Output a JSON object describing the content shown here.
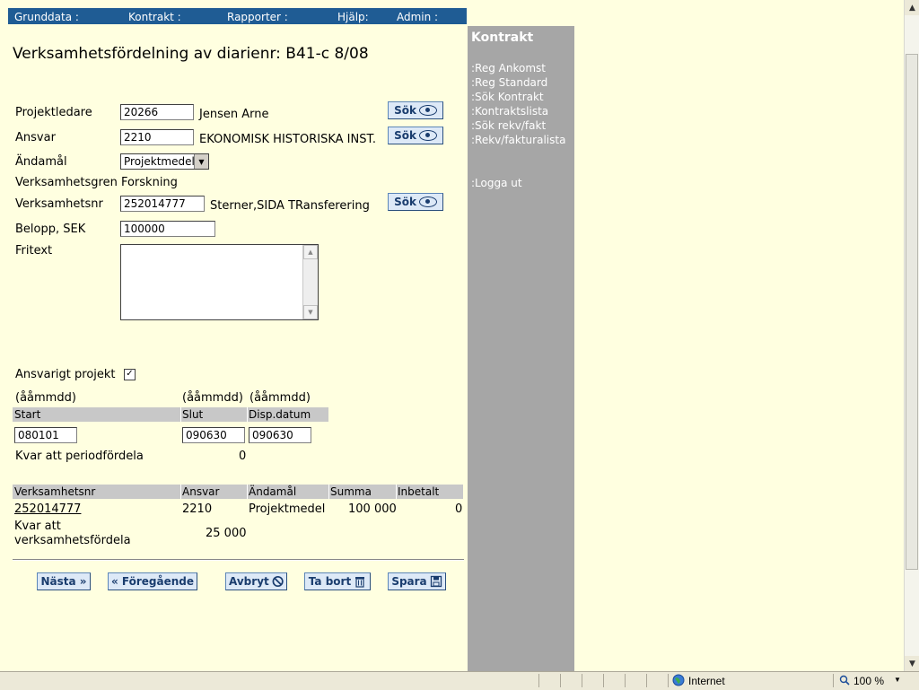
{
  "topnav": {
    "grunddata": "Grunddata :",
    "kontrakt": "Kontrakt :",
    "rapporter": "Rapporter :",
    "hjalp": "Hjälp:",
    "admin": "Admin :"
  },
  "page_title": "Verksamhetsfördelning av diarienr: B41-c 8/08",
  "form": {
    "projektledare_label": "Projektledare",
    "projektledare_value": "20266",
    "projektledare_name": "Jensen Arne",
    "ansvar_label": "Ansvar",
    "ansvar_value": "2210",
    "ansvar_name": "EKONOMISK HISTORISKA INST.",
    "andamal_label": "Ändamål",
    "andamal_value": "Projektmedel",
    "verksamhetsgren_label": "Verksamhetsgren",
    "verksamhetsgren_value": "Forskning",
    "verksamhetsnr_label": "Verksamhetsnr",
    "verksamhetsnr_value": "252014777",
    "verksamhetsnr_name": "Sterner,SIDA TRansferering",
    "belopp_label": "Belopp, SEK",
    "belopp_value": "100000",
    "fritext_label": "Fritext",
    "fritext_value": "",
    "sok_label": "Sök",
    "ansvarigt_label": "Ansvarigt projekt",
    "ansvarigt_checked": true
  },
  "period": {
    "format_hint": "(ååmmdd)",
    "start_header": "Start",
    "slut_header": "Slut",
    "disp_header": "Disp.datum",
    "start_value": "080101",
    "slut_value": "090630",
    "disp_value": "090630",
    "kvar_label": "Kvar att periodfördela",
    "kvar_value": "0"
  },
  "table": {
    "headers": [
      "Verksamhetsnr",
      "Ansvar",
      "Ändamål",
      "Summa",
      "Inbetalt"
    ],
    "rows": [
      {
        "verksamhetsnr": "252014777",
        "ansvar": "2210",
        "andamal": "Projektmedel",
        "summa": "100 000",
        "inbetalt": "0"
      }
    ],
    "kvar_label_1": "Kvar att",
    "kvar_label_2": "verksamhetsfördela",
    "kvar_value": "25 000"
  },
  "buttons": {
    "nasta": "Nästa »",
    "foregaende": "« Föregående",
    "avbryt": "Avbryt",
    "tabort": "Ta bort",
    "spara": "Spara"
  },
  "sidebar": {
    "heading": "Kontrakt",
    "items": [
      ":Reg Ankomst",
      ":Reg Standard",
      ":Sök Kontrakt",
      ":Kontraktslista",
      ":Sök rekv/fakt",
      ":Rekv/fakturalista"
    ],
    "logout": ":Logga ut"
  },
  "statusbar": {
    "zone": "Internet",
    "zoom": "100 %"
  }
}
